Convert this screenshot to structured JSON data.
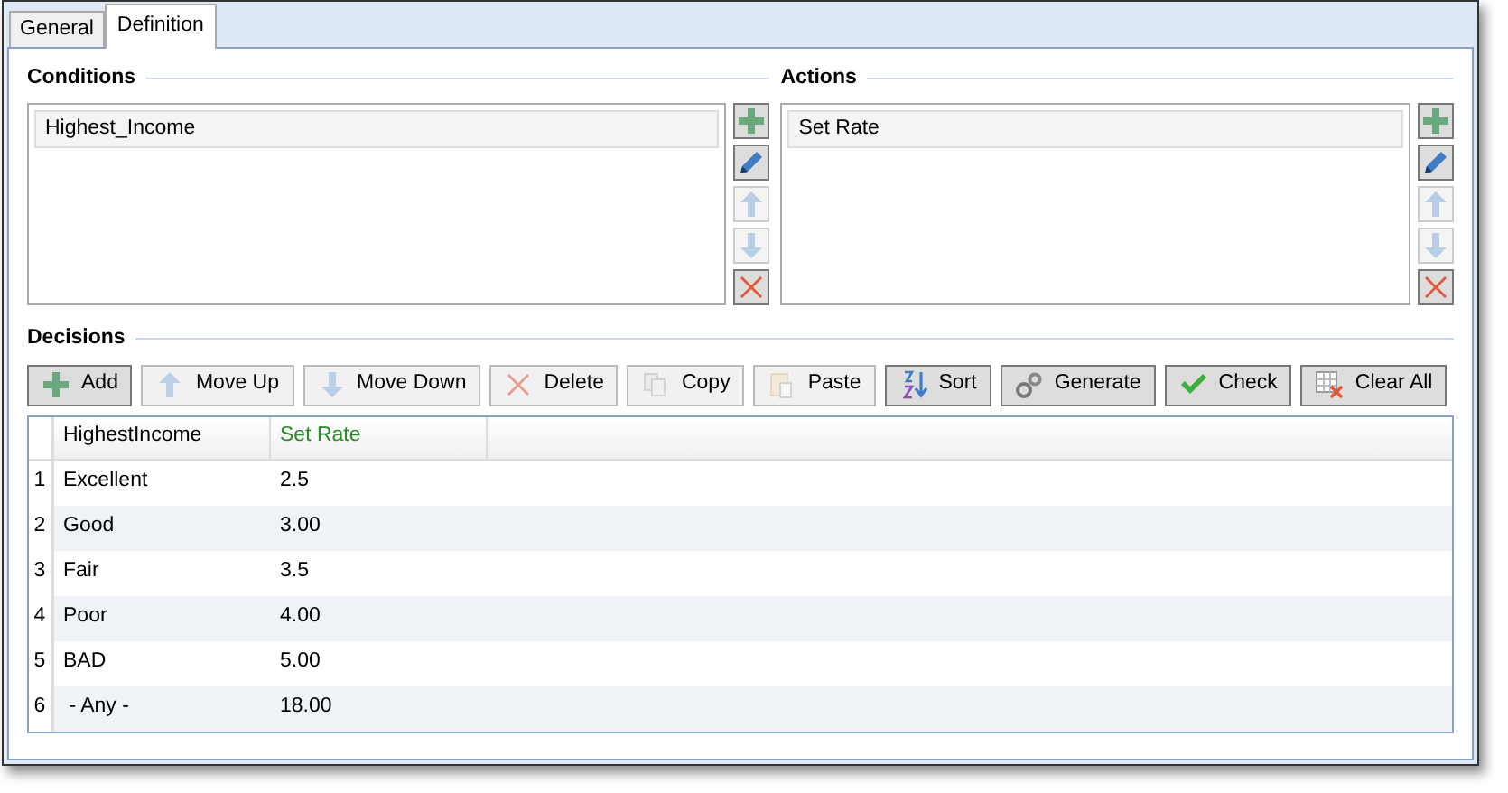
{
  "tabs": [
    {
      "label": "General",
      "selected": false
    },
    {
      "label": "Definition",
      "selected": true
    }
  ],
  "conditions": {
    "title": "Conditions",
    "items": [
      {
        "label": "Highest_Income",
        "selected": true
      }
    ],
    "buttons": [
      {
        "kind": "add",
        "disabled": false
      },
      {
        "kind": "edit",
        "disabled": false
      },
      {
        "kind": "up",
        "disabled": true
      },
      {
        "kind": "down",
        "disabled": true
      },
      {
        "kind": "delete",
        "disabled": false
      }
    ]
  },
  "actions": {
    "title": "Actions",
    "items": [
      {
        "label": "Set Rate",
        "selected": true
      }
    ],
    "buttons": [
      {
        "kind": "add",
        "disabled": false
      },
      {
        "kind": "edit",
        "disabled": false
      },
      {
        "kind": "up",
        "disabled": true
      },
      {
        "kind": "down",
        "disabled": true
      },
      {
        "kind": "delete",
        "disabled": false
      }
    ]
  },
  "decisions": {
    "title": "Decisions",
    "toolbar": [
      {
        "kind": "add",
        "label": "Add",
        "disabled": false
      },
      {
        "kind": "up",
        "label": "Move Up",
        "disabled": true
      },
      {
        "kind": "down",
        "label": "Move Down",
        "disabled": true
      },
      {
        "kind": "delete",
        "label": "Delete",
        "disabled": true
      },
      {
        "kind": "copy",
        "label": "Copy",
        "disabled": true
      },
      {
        "kind": "paste",
        "label": "Paste",
        "disabled": true
      },
      {
        "kind": "sort",
        "label": "Sort",
        "disabled": false
      },
      {
        "kind": "generate",
        "label": "Generate",
        "disabled": false
      },
      {
        "kind": "check",
        "label": "Check",
        "disabled": false
      },
      {
        "kind": "clear",
        "label": "Clear All",
        "disabled": false
      }
    ],
    "columns": [
      {
        "label": "HighestIncome",
        "kind": "condition"
      },
      {
        "label": "Set Rate",
        "kind": "action"
      }
    ],
    "rows": [
      {
        "number": "1",
        "cells": [
          "Excellent",
          "2.5"
        ]
      },
      {
        "number": "2",
        "cells": [
          "Good",
          "3.00"
        ]
      },
      {
        "number": "3",
        "cells": [
          "Fair",
          "3.5"
        ]
      },
      {
        "number": "4",
        "cells": [
          "Poor",
          "4.00"
        ]
      },
      {
        "number": "5",
        "cells": [
          "BAD",
          "5.00"
        ]
      },
      {
        "number": "6",
        "cells": [
          " - Any -",
          "18.00"
        ]
      }
    ]
  }
}
